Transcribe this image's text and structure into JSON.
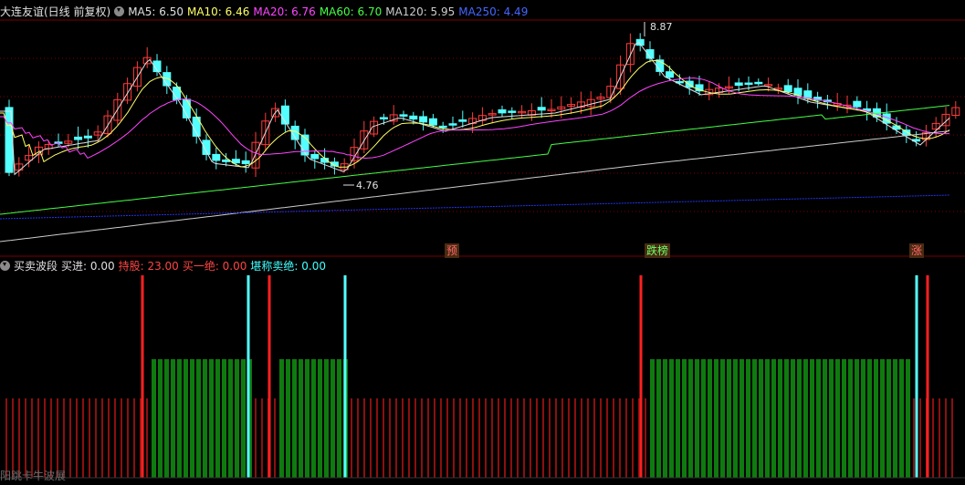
{
  "top": {
    "title": "大连友谊(日线 前复权)",
    "ma": [
      {
        "label": "MA5: 6.50",
        "color": "#e0e0e0"
      },
      {
        "label": "MA10: 6.46",
        "color": "#ffff66"
      },
      {
        "label": "MA20: 6.76",
        "color": "#ff44ff"
      },
      {
        "label": "MA60: 6.70",
        "color": "#44ff44"
      },
      {
        "label": "MA120: 5.95",
        "color": "#cccccc"
      },
      {
        "label": "MA250: 4.49",
        "color": "#4466ff"
      }
    ]
  },
  "annotations": {
    "high": "8.87",
    "low": "4.76"
  },
  "badges": [
    {
      "text": "预",
      "color": "#ff6666"
    },
    {
      "text": "跌榜",
      "color": "#66ff66"
    },
    {
      "text": "涨",
      "color": "#ff6666"
    }
  ],
  "bottom": {
    "title": "买卖波段",
    "items": [
      {
        "label": "买进: 0.00",
        "color": "#e0e0e0"
      },
      {
        "label": "持股: 23.00",
        "color": "#ff4444"
      },
      {
        "label": "买一绝: 0.00",
        "color": "#ff4444"
      },
      {
        "label": "堪称卖绝: 0.00",
        "color": "#44ffff"
      }
    ],
    "footer": "阳跳卡牛波展"
  },
  "colors": {
    "up": "#ff3b3b",
    "down": "#54ffff",
    "ma5": "#e0e0e0",
    "ma10": "#ffff66",
    "ma20": "#ff44ff",
    "ma60": "#44ff44",
    "ma120": "#cccccc",
    "ma250": "#2233ee",
    "grid": "#7a0000",
    "hold": "#0f7a0f",
    "idle": "#8b1010",
    "sellSignal": "#54ffff",
    "buySignal": "#ff2020"
  }
}
